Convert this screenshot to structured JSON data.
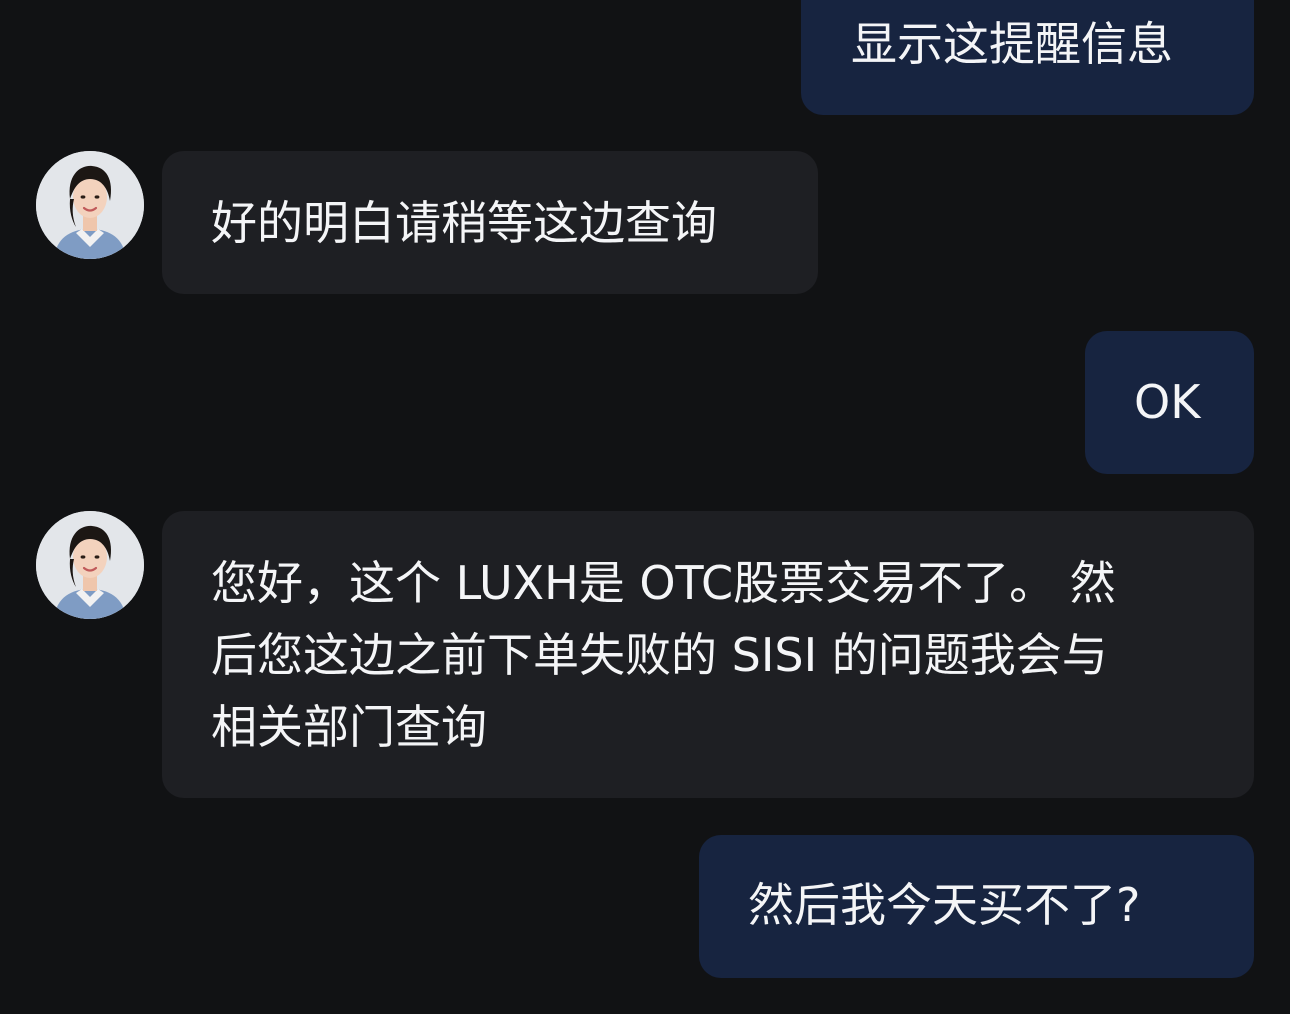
{
  "messages": [
    {
      "sender": "user",
      "text": "显示这提醒信息"
    },
    {
      "sender": "agent",
      "text": "好的明白请稍等这边查询"
    },
    {
      "sender": "user",
      "text": "OK"
    },
    {
      "sender": "agent",
      "lines": [
        "您好，这个 LUXH是 OTC股票交易不了。 然",
        "后您这边之前下单失败的 SISI 的问题我会与",
        "相关部门查询"
      ]
    },
    {
      "sender": "user",
      "text": "然后我今天买不了?"
    }
  ],
  "colors": {
    "background": "#111214",
    "user_bubble": "#172440",
    "agent_bubble": "#1e1f23",
    "text": "#f4f5f7"
  },
  "icons": {
    "agent_avatar": "agent-avatar"
  }
}
